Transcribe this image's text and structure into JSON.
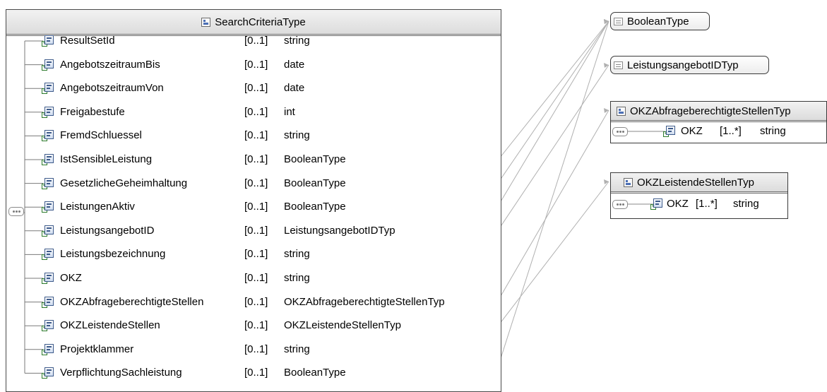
{
  "main_type": {
    "title": "SearchCriteriaType",
    "elements": [
      {
        "name": "ResultSetId",
        "cardinality": "[0..1]",
        "type": "string"
      },
      {
        "name": "AngebotszeitraumBis",
        "cardinality": "[0..1]",
        "type": "date"
      },
      {
        "name": "AngebotszeitraumVon",
        "cardinality": "[0..1]",
        "type": "date"
      },
      {
        "name": "Freigabestufe",
        "cardinality": "[0..1]",
        "type": "int"
      },
      {
        "name": "FremdSchluessel",
        "cardinality": "[0..1]",
        "type": "string"
      },
      {
        "name": "IstSensibleLeistung",
        "cardinality": "[0..1]",
        "type": "BooleanType"
      },
      {
        "name": "GesetzlicheGeheimhaltung",
        "cardinality": "[0..1]",
        "type": "BooleanType"
      },
      {
        "name": "LeistungenAktiv",
        "cardinality": "[0..1]",
        "type": "BooleanType"
      },
      {
        "name": "LeistungsangebotID",
        "cardinality": "[0..1]",
        "type": "LeistungsangebotIDTyp"
      },
      {
        "name": "Leistungsbezeichnung",
        "cardinality": "[0..1]",
        "type": "string"
      },
      {
        "name": "OKZ",
        "cardinality": "[0..1]",
        "type": "string"
      },
      {
        "name": "OKZAbfrageberechtigteStellen",
        "cardinality": "[0..1]",
        "type": "OKZAbfrageberechtigteStellenTyp"
      },
      {
        "name": "OKZLeistendeStellen",
        "cardinality": "[0..1]",
        "type": "OKZLeistendeStellenTyp"
      },
      {
        "name": "Projektklammer",
        "cardinality": "[0..1]",
        "type": "string"
      },
      {
        "name": "VerpflichtungSachleistung",
        "cardinality": "[0..1]",
        "type": "BooleanType"
      }
    ]
  },
  "simple_types": [
    {
      "name": "BooleanType"
    },
    {
      "name": "LeistungsangebotIDTyp"
    }
  ],
  "complex_types": [
    {
      "name": "OKZAbfrageberechtigteStellenTyp",
      "element": {
        "name": "OKZ",
        "cardinality": "[1..*]",
        "type": "string"
      }
    },
    {
      "name": "OKZLeistendeStellenTyp",
      "element": {
        "name": "OKZ",
        "cardinality": "[1..*]",
        "type": "string"
      }
    }
  ],
  "colors": {
    "border": "#4a4a4a",
    "connector": "#b0b0b0",
    "icon_blue": "#3d5a8a",
    "icon_green": "#2c7a2c"
  },
  "icons": [
    "complex-type-icon",
    "simple-type-icon",
    "element-icon",
    "sequence-icon"
  ]
}
